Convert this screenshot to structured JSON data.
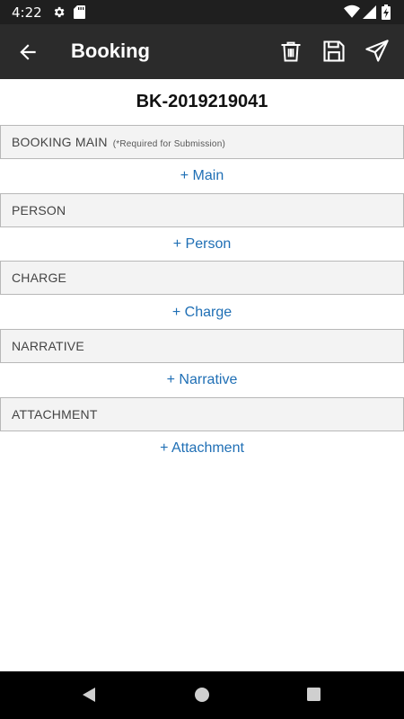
{
  "status_bar": {
    "time": "4:22",
    "icons": [
      "gear-icon",
      "sd-card-icon",
      "wifi-icon",
      "signal-icon",
      "battery-icon"
    ]
  },
  "app_bar": {
    "title": "Booking",
    "actions": [
      "trash-icon",
      "save-icon",
      "send-icon"
    ]
  },
  "record": {
    "id": "BK-2019219041"
  },
  "sections": [
    {
      "header": "BOOKING MAIN",
      "note": "(*Required for Submission)",
      "add_label": "+ Main"
    },
    {
      "header": "PERSON",
      "note": "",
      "add_label": "+ Person"
    },
    {
      "header": "CHARGE",
      "note": "",
      "add_label": "+ Charge"
    },
    {
      "header": "NARRATIVE",
      "note": "",
      "add_label": "+ Narrative"
    },
    {
      "header": "ATTACHMENT",
      "note": "",
      "add_label": "+ Attachment"
    }
  ],
  "colors": {
    "app_bar": "#2b2b2b",
    "status_bar": "#1f1f1f",
    "link": "#1f6fb5",
    "header_bg": "#f3f3f3"
  }
}
